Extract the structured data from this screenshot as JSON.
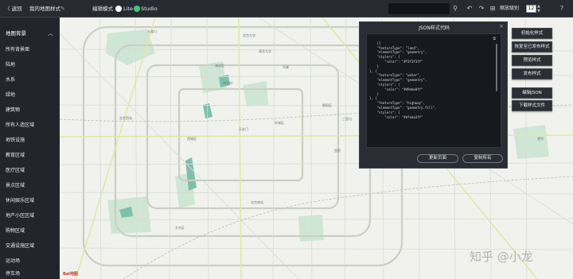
{
  "topbar": {
    "back_label": "〈 返回",
    "style_name": "我的地图样式",
    "edit_mode_label": "编辑模式",
    "mode_lite": "Lite",
    "mode_studio": "Studio",
    "zoom_label": "缩放级别",
    "zoom_value": "12",
    "icons": [
      "edit-icon",
      "search-icon",
      "undo-icon",
      "redo-icon",
      "grid-icon",
      "help-icon"
    ]
  },
  "sidebar": {
    "header": "地图背景",
    "items": [
      "所有背景面",
      "陆地",
      "水系",
      "绿地",
      "建筑物",
      "所有人造区域",
      "地铁设施",
      "教育区域",
      "医疗区域",
      "景点区域",
      "休闲娱乐区域",
      "地产小区区域",
      "购物区域",
      "交通设施区域",
      "运动场",
      "停车场"
    ]
  },
  "json_panel": {
    "title": "JSON样式代码",
    "code": "[{\n    \"featureType\": \"land\",\n    \"elementType\": \"geometry\",\n    \"stylers\": {\n        \"color\": \"#f3f3f3ff\"\n    }\n}, {\n    \"featureType\": \"water\",\n    \"elementType\": \"geometry\",\n    \"stylers\": {\n        \"color\": \"#d9ebe8ff\"\n    }\n}, {\n    \"featureType\": \"highway\",\n    \"elementType\": \"geometry.fill\",\n    \"stylers\": {\n        \"color\": \"#dfeaa3ff\"",
    "update_button": "更新页面",
    "copy_all_button": "复制所有"
  },
  "right_actions": [
    "初始化样式",
    "恢复至已发布样式",
    "预览样式",
    "发布样式",
    "编辑JSON",
    "下载样式文件"
  ],
  "map": {
    "logo": "Bai地图",
    "watermark": "知乎 @小龙",
    "labels": [
      "北京大学",
      "清华大学",
      "海淀区",
      "中关村",
      "北京西站",
      "天安门",
      "东城区",
      "西城区",
      "朝阳区",
      "丰台区",
      "国贸",
      "北京南站",
      "三里屯",
      "五道口",
      "望京",
      "鸟巢"
    ]
  },
  "colors": {
    "topbar_bg": "#272b31",
    "sidebar_bg": "#22262c",
    "map_bg": "#f1f2ee",
    "green": "#3fc87a",
    "highway": "#dfeaa3"
  }
}
